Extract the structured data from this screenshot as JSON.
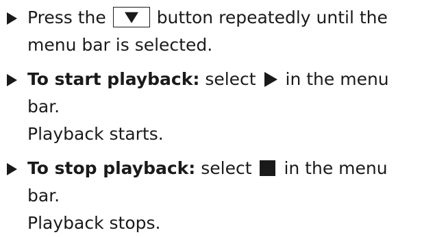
{
  "steps": [
    {
      "pre": "Press the",
      "post": "button repeatedly until the",
      "cont": "menu bar is selected.",
      "button_icon": "down-arrow-button-icon"
    },
    {
      "bold": "To start playback:",
      "pre": "select",
      "post": "in the menu",
      "cont": "bar.",
      "result": "Playback starts.",
      "icon": "play-icon"
    },
    {
      "bold": "To stop playback:",
      "pre": "select",
      "post": "in the menu",
      "cont": "bar.",
      "result": "Playback stops.",
      "icon": "stop-icon"
    }
  ],
  "colors": {
    "text": "#1a1a1a",
    "background": "#ffffff"
  }
}
